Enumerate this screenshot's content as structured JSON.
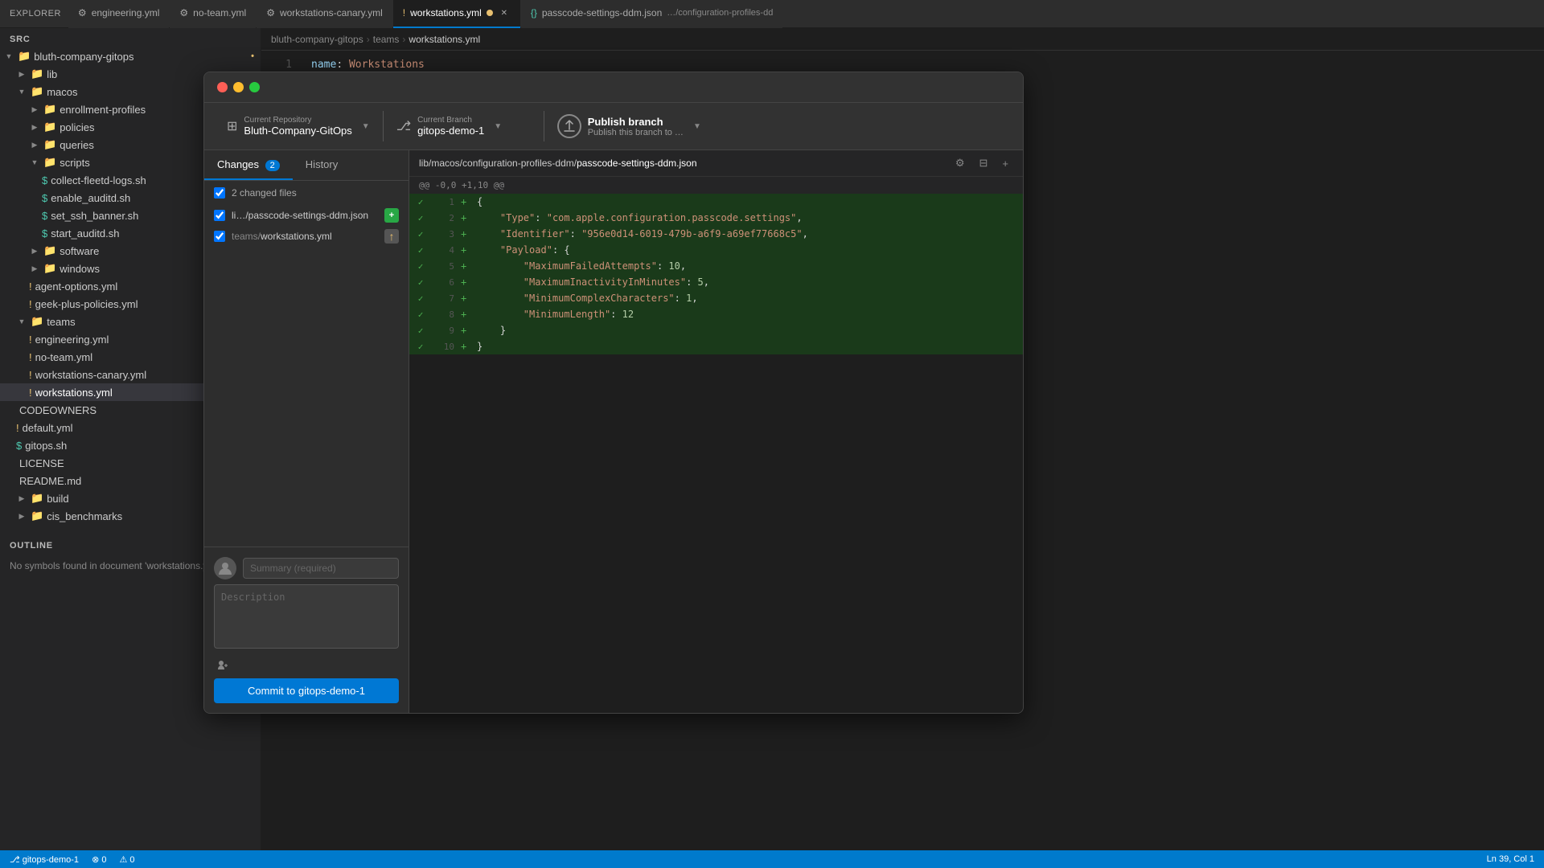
{
  "tabBar": {
    "explorerLabel": "EXPLORER",
    "tabs": [
      {
        "id": "engineering",
        "label": "engineering.yml",
        "icon": "⚙",
        "active": false,
        "modified": false
      },
      {
        "id": "no-team",
        "label": "no-team.yml",
        "icon": "⚙",
        "active": false,
        "modified": false
      },
      {
        "id": "workstations-canary",
        "label": "workstations-canary.yml",
        "icon": "⚙",
        "active": false,
        "modified": false
      },
      {
        "id": "workstations",
        "label": "workstations.yml",
        "icon": "!",
        "active": true,
        "modified": true
      },
      {
        "id": "passcode-settings",
        "label": "passcode-settings-ddm.json",
        "icon": "{}",
        "active": false,
        "modified": false,
        "path": "…/configuration-profiles-dd"
      }
    ]
  },
  "sidebar": {
    "title": "EXPLORER",
    "sections": [
      {
        "name": "src",
        "label": "SRC",
        "items": [
          {
            "label": "bluth-company-gitops",
            "depth": 0,
            "type": "folder",
            "open": true
          },
          {
            "label": "lib",
            "depth": 1,
            "type": "folder",
            "open": false
          },
          {
            "label": "macos",
            "depth": 1,
            "type": "folder",
            "open": true
          },
          {
            "label": "enrollment-profiles",
            "depth": 2,
            "type": "folder",
            "open": false
          },
          {
            "label": "policies",
            "depth": 2,
            "type": "folder",
            "open": false
          },
          {
            "label": "queries",
            "depth": 2,
            "type": "folder",
            "open": false
          },
          {
            "label": "scripts",
            "depth": 2,
            "type": "folder",
            "open": true
          },
          {
            "label": "collect-fleetd-logs.sh",
            "depth": 3,
            "type": "file",
            "icon": "$"
          },
          {
            "label": "enable_auditd.sh",
            "depth": 3,
            "type": "file",
            "icon": "$"
          },
          {
            "label": "set_ssh_banner.sh",
            "depth": 3,
            "type": "file",
            "icon": "$"
          },
          {
            "label": "start_auditd.sh",
            "depth": 3,
            "type": "file",
            "icon": "$"
          },
          {
            "label": "software",
            "depth": 2,
            "type": "folder",
            "open": false
          },
          {
            "label": "windows",
            "depth": 2,
            "type": "folder",
            "open": false
          },
          {
            "label": "agent-options.yml",
            "depth": 2,
            "type": "file",
            "icon": "!"
          },
          {
            "label": "geek-plus-policies.yml",
            "depth": 2,
            "type": "file",
            "icon": "!"
          },
          {
            "label": "teams",
            "depth": 1,
            "type": "folder",
            "open": true
          },
          {
            "label": "engineering.yml",
            "depth": 2,
            "type": "file",
            "icon": "!"
          },
          {
            "label": "no-team.yml",
            "depth": 2,
            "type": "file",
            "icon": "!"
          },
          {
            "label": "workstations-canary.yml",
            "depth": 2,
            "type": "file",
            "icon": "!"
          },
          {
            "label": "workstations.yml",
            "depth": 2,
            "type": "file",
            "icon": "!",
            "active": true
          },
          {
            "label": "CODEOWNERS",
            "depth": 1,
            "type": "file",
            "icon": ""
          },
          {
            "label": "default.yml",
            "depth": 1,
            "type": "file",
            "icon": "!"
          },
          {
            "label": "gitops.sh",
            "depth": 1,
            "type": "file",
            "icon": "$"
          },
          {
            "label": "LICENSE",
            "depth": 1,
            "type": "file",
            "icon": ""
          },
          {
            "label": "README.md",
            "depth": 1,
            "type": "file",
            "icon": ""
          },
          {
            "label": "build",
            "depth": 1,
            "type": "folder",
            "open": false
          },
          {
            "label": "cis_benchmarks",
            "depth": 1,
            "type": "folder",
            "open": false
          }
        ]
      }
    ],
    "outline": {
      "title": "OUTLINE",
      "message": "No symbols found in document 'workstations.yml'"
    }
  },
  "breadcrumb": {
    "parts": [
      "bluth-company-gitops",
      "teams",
      "workstations.yml"
    ]
  },
  "editorLine": {
    "lineNum": 1,
    "content": "name: Workstations"
  },
  "github": {
    "repo": {
      "label": "Current Repository",
      "value": "Bluth-Company-GitOps"
    },
    "branch": {
      "label": "Current Branch",
      "value": "gitops-demo-1"
    },
    "publish": {
      "label": "Publish branch",
      "sublabel": "Publish this branch to …"
    },
    "tabs": {
      "changes": "Changes",
      "changesBadge": "2",
      "history": "History"
    },
    "changedFiles": {
      "header": "2 changed files",
      "files": [
        {
          "name": "li…/passcode-settings-ddm.json",
          "dir": "",
          "badge": "+",
          "badgeType": "added"
        },
        {
          "name": "workstations.yml",
          "dir": "teams/",
          "badge": "↑",
          "badgeType": "modified"
        }
      ]
    },
    "diff": {
      "filepath": "lib/macos/configuration-profiles-ddm/",
      "filename": "passcode-settings-ddm.json",
      "hunkHeader": "@@ -0,0 +1,10 @@",
      "lines": [
        {
          "num": 1,
          "sign": "+",
          "content": "{"
        },
        {
          "num": 2,
          "sign": "+",
          "content": "    \"Type\": \"com.apple.configuration.passcode.settings\","
        },
        {
          "num": 3,
          "sign": "+",
          "content": "    \"Identifier\": \"956e0d14-6019-479b-a6f9-a69ef77668c5\","
        },
        {
          "num": 4,
          "sign": "+",
          "content": "    \"Payload\": {"
        },
        {
          "num": 5,
          "sign": "+",
          "content": "        \"MaximumFailedAttempts\": 10,"
        },
        {
          "num": 6,
          "sign": "+",
          "content": "        \"MaximumInactivityInMinutes\": 5,"
        },
        {
          "num": 7,
          "sign": "+",
          "content": "        \"MinimumComplexCharacters\": 1,"
        },
        {
          "num": 8,
          "sign": "+",
          "content": "        \"MinimumLength\": 12"
        },
        {
          "num": 9,
          "sign": "+",
          "content": "    }"
        },
        {
          "num": 10,
          "sign": "+",
          "content": "}"
        }
      ]
    },
    "commit": {
      "summaryPlaceholder": "Summary (required)",
      "descriptionPlaceholder": "Description",
      "buttonLabel": "Commit to gitops-demo-1"
    }
  },
  "statusBar": {
    "branch": "gitops-demo-1",
    "errors": "0",
    "warnings": "0",
    "line": "Ln 39, Col 1"
  }
}
